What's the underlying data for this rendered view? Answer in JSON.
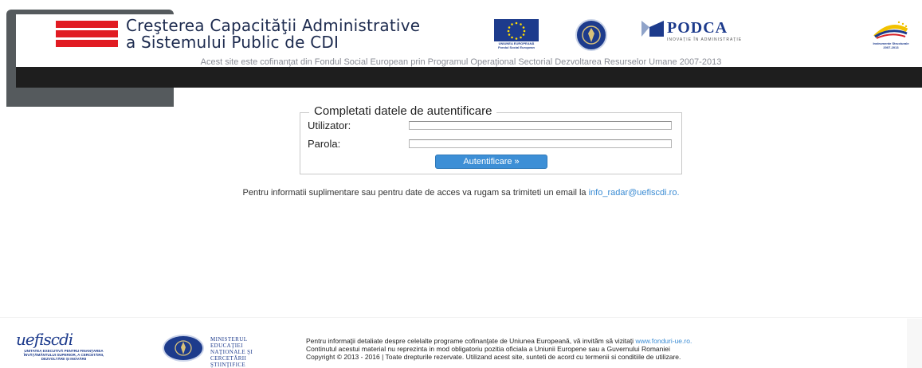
{
  "header": {
    "title_line1": "Creşterea Capacităţii Administrative",
    "title_line2": "a Sistemului Public de CDI",
    "eu_caption": "UNIUNEA EUROPEANĂ Fondul Social European",
    "podca_name": "PODCA",
    "podca_tagline": "INOVAŢIE ÎN ADMINISTRAŢIE",
    "struct_caption": "Instrumente Structurale 2007-2013",
    "cofinanced_text": "Acest site este cofinanţat din Fondul Social European prin Programul Operaţional Sectorial Dezvoltarea Resurselor Umane 2007-2013"
  },
  "login": {
    "legend": "Completati datele de autentificare",
    "user_label": "Utilizator:",
    "user_value": "",
    "pass_label": "Parola:",
    "pass_value": "",
    "submit_label": "Autentificare »"
  },
  "info": {
    "text": "Pentru informatii suplimentare sau pentru date de acces va rugam sa trimiteti un email la",
    "email": "info_radar@uefiscdi.ro."
  },
  "footer": {
    "uef_logo_text": "uefiscdi",
    "uef_subtitle": "UNITATEA EXECUTIVĂ PENTRU FINANŢAREA ÎNVĂŢĂMÂNTULUI SUPERIOR, A CERCETĂRII, DEZVOLTĂRII ŞI INOVĂRII",
    "ministry_line1": "MINISTERUL",
    "ministry_line2": "EDUCAŢIEI",
    "ministry_line3": "NAŢIONALE ŞI",
    "ministry_line4": "CERCETĂRII",
    "ministry_line5": "ŞTIINŢIFICE",
    "line1_text": "Pentru informaţii detaliate despre celelalte programe cofinanţate de Uniunea Europeană, vă invităm să vizitaţi",
    "line1_link": "www.fonduri-ue.ro.",
    "line2": "Continutul acestui material nu reprezinta in mod obligatoriu pozitia oficiala a Uniunii Europene sau a Guvernului Romaniei",
    "line3": "Copyright © 2013 - 2016 | Toate drepturile rezervate. Utilizand acest site, sunteti de acord cu termenii si conditiile de utilizare."
  },
  "colors": {
    "brand_red": "#e11b22",
    "brand_blue": "#1d3b8c",
    "button_blue": "#3d8fd6",
    "link_blue": "#3a8bd3",
    "nav_bar": "#1e1e1e"
  }
}
